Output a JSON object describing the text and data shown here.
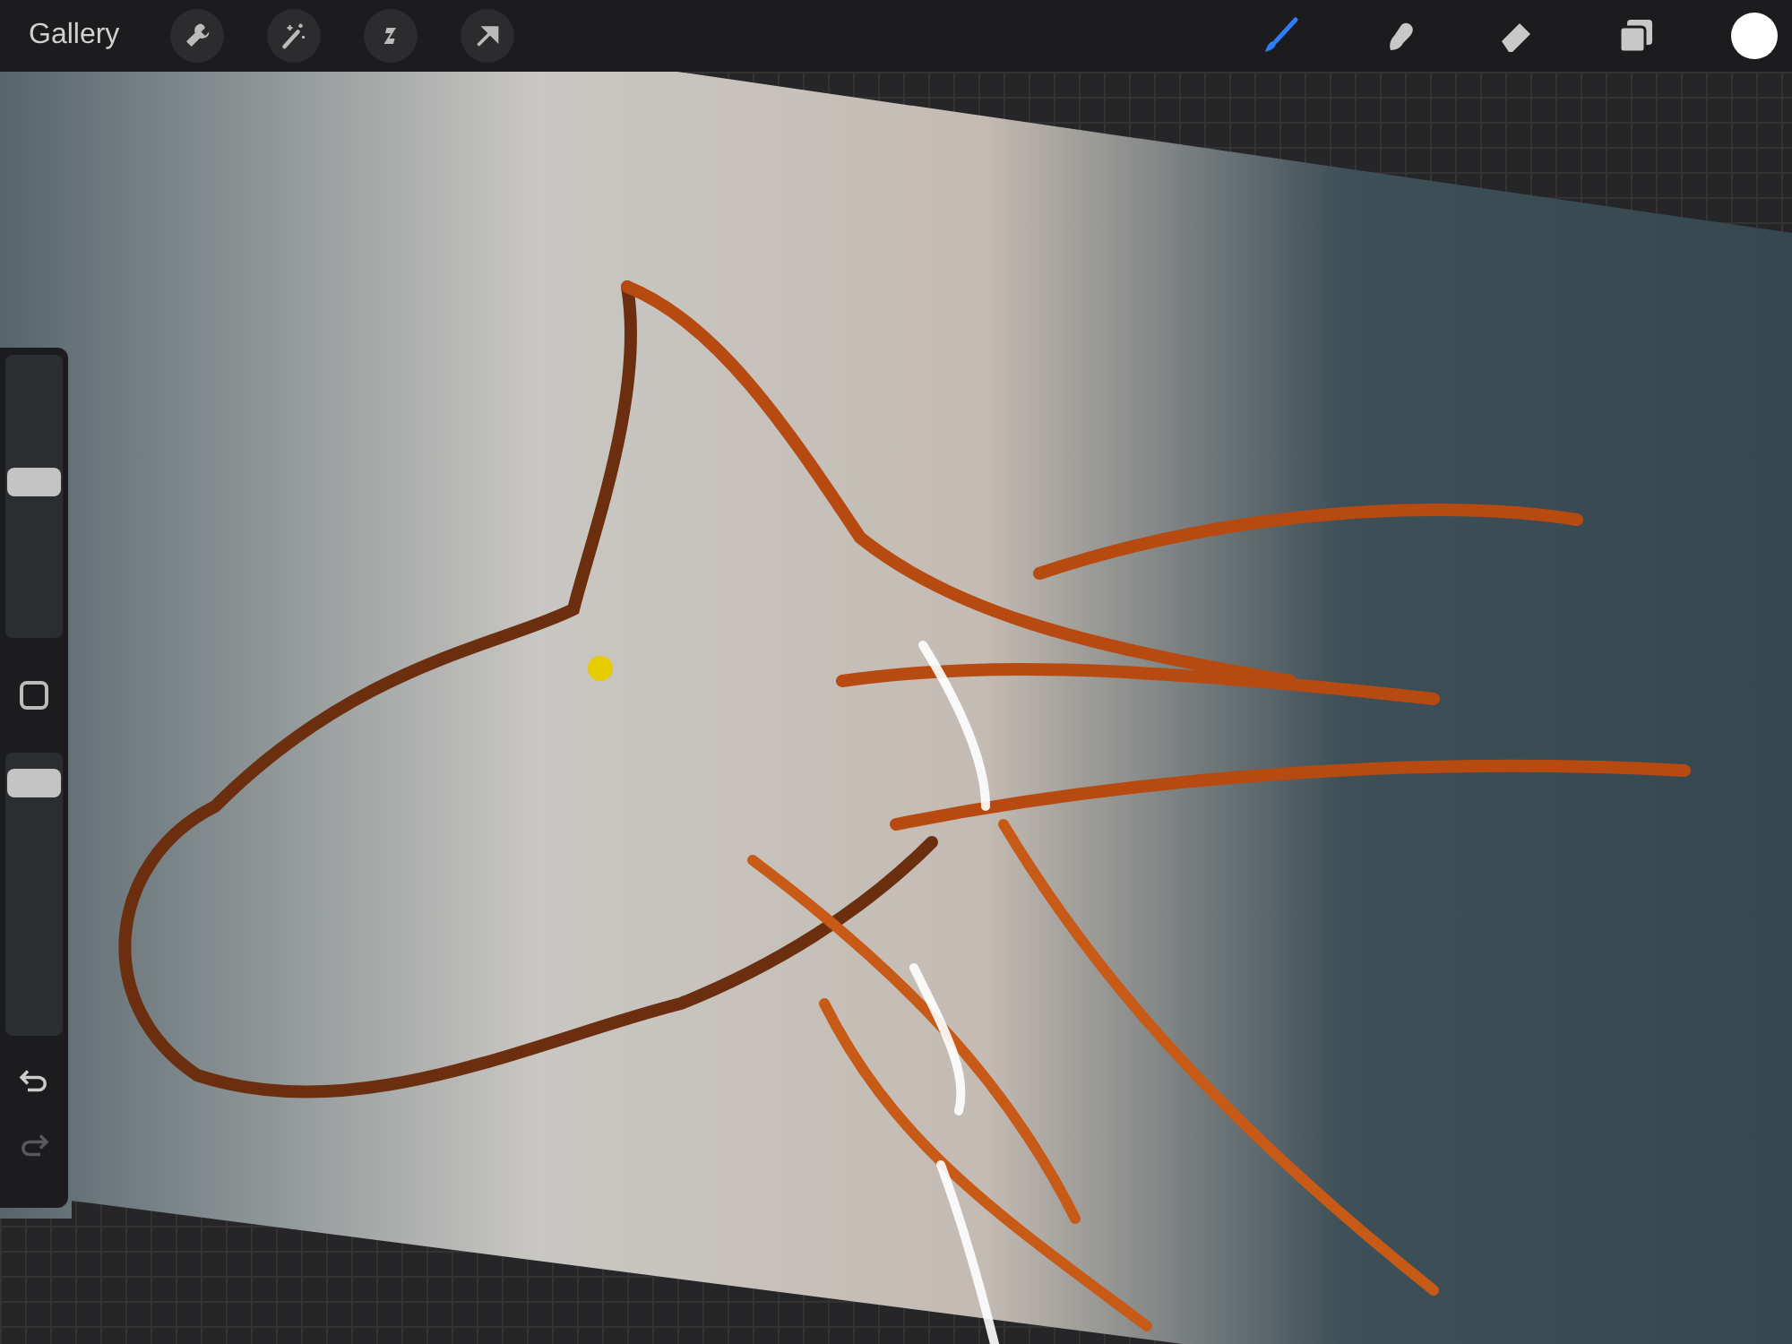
{
  "top_bar": {
    "gallery_label": "Gallery",
    "actions": [
      {
        "kind": "wrench"
      },
      {
        "kind": "wand"
      },
      {
        "kind": "selection"
      },
      {
        "kind": "transform"
      }
    ],
    "tools": [
      {
        "kind": "brush",
        "selected": true
      },
      {
        "kind": "smudge",
        "selected": false
      },
      {
        "kind": "eraser",
        "selected": false
      },
      {
        "kind": "layers",
        "selected": false
      }
    ],
    "current_color": {
      "color": "#ffffff"
    }
  },
  "sidebar": {
    "brush_size": {
      "level": 0.55
    },
    "opacity": {
      "level": 0.89
    },
    "undo": {
      "disabled": false
    },
    "redo": {
      "disabled": true
    }
  }
}
